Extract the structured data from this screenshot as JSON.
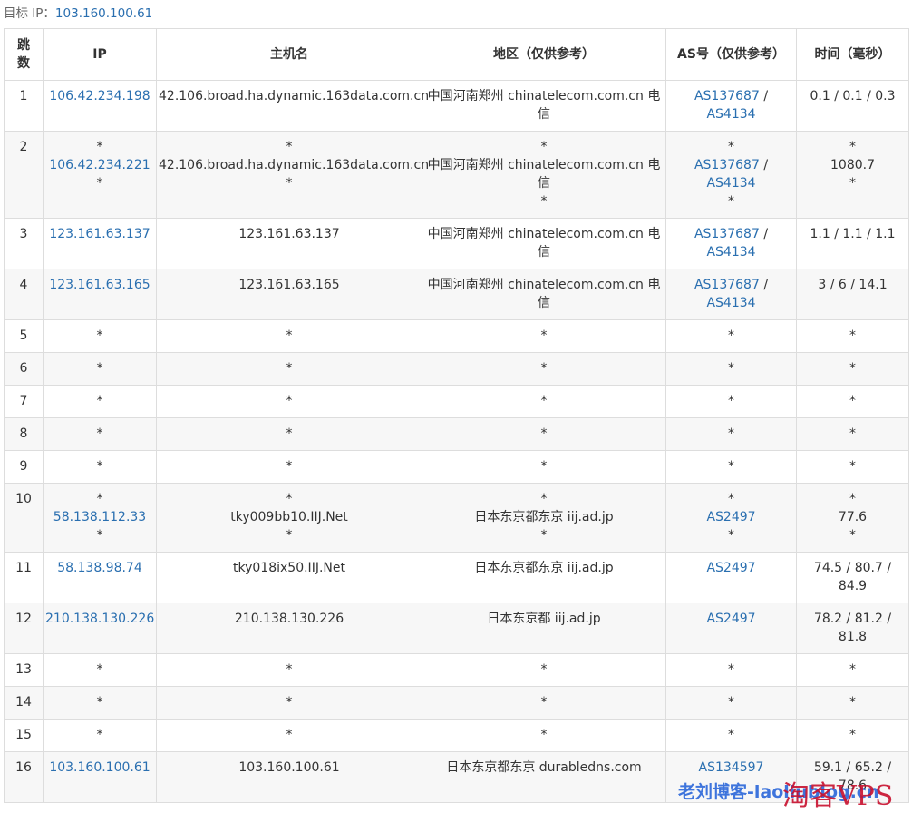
{
  "target": {
    "label": "目标 IP：",
    "ip": "103.160.100.61"
  },
  "headers": {
    "hop": "跳数",
    "ip": "IP",
    "host": "主机名",
    "region": "地区（仅供参考）",
    "as": "AS号（仅供参考）",
    "time": "时间（毫秒）"
  },
  "rows": [
    {
      "hop": "1",
      "ip": [
        {
          "t": "106.42.234.198",
          "link": true
        }
      ],
      "host": [
        "42.106.broad.ha.dynamic.163data.com.cn"
      ],
      "region": [
        "中国河南郑州 chinatelecom.com.cn 电",
        "信"
      ],
      "as": [
        [
          {
            "t": "AS137687",
            "link": true
          },
          {
            "t": " /",
            "link": false
          }
        ],
        [
          {
            "t": "AS4134",
            "link": true
          }
        ]
      ],
      "time": [
        "0.1 / 0.1 / 0.3"
      ]
    },
    {
      "hop": "2",
      "ip": [
        {
          "t": "*",
          "link": false
        },
        {
          "t": "106.42.234.221",
          "link": true
        },
        {
          "t": "*",
          "link": false
        }
      ],
      "host": [
        "*",
        "42.106.broad.ha.dynamic.163data.com.cn",
        "*"
      ],
      "region": [
        "*",
        "中国河南郑州 chinatelecom.com.cn 电",
        "信",
        "*"
      ],
      "as": [
        [
          {
            "t": "*",
            "link": false
          }
        ],
        [
          {
            "t": "AS137687",
            "link": true
          },
          {
            "t": " /",
            "link": false
          }
        ],
        [
          {
            "t": "AS4134",
            "link": true
          }
        ],
        [
          {
            "t": "*",
            "link": false
          }
        ]
      ],
      "time": [
        "*",
        "1080.7",
        "*"
      ]
    },
    {
      "hop": "3",
      "ip": [
        {
          "t": "123.161.63.137",
          "link": true
        }
      ],
      "host": [
        "123.161.63.137"
      ],
      "region": [
        "中国河南郑州 chinatelecom.com.cn 电",
        "信"
      ],
      "as": [
        [
          {
            "t": "AS137687",
            "link": true
          },
          {
            "t": " /",
            "link": false
          }
        ],
        [
          {
            "t": "AS4134",
            "link": true
          }
        ]
      ],
      "time": [
        "1.1 / 1.1 / 1.1"
      ]
    },
    {
      "hop": "4",
      "ip": [
        {
          "t": "123.161.63.165",
          "link": true
        }
      ],
      "host": [
        "123.161.63.165"
      ],
      "region": [
        "中国河南郑州 chinatelecom.com.cn 电",
        "信"
      ],
      "as": [
        [
          {
            "t": "AS137687",
            "link": true
          },
          {
            "t": " /",
            "link": false
          }
        ],
        [
          {
            "t": "AS4134",
            "link": true
          }
        ]
      ],
      "time": [
        "3 / 6 / 14.1"
      ]
    },
    {
      "hop": "5",
      "ip": [
        {
          "t": "*",
          "link": false
        }
      ],
      "host": [
        "*"
      ],
      "region": [
        "*"
      ],
      "as": [
        [
          {
            "t": "*",
            "link": false
          }
        ]
      ],
      "time": [
        "*"
      ]
    },
    {
      "hop": "6",
      "ip": [
        {
          "t": "*",
          "link": false
        }
      ],
      "host": [
        "*"
      ],
      "region": [
        "*"
      ],
      "as": [
        [
          {
            "t": "*",
            "link": false
          }
        ]
      ],
      "time": [
        "*"
      ]
    },
    {
      "hop": "7",
      "ip": [
        {
          "t": "*",
          "link": false
        }
      ],
      "host": [
        "*"
      ],
      "region": [
        "*"
      ],
      "as": [
        [
          {
            "t": "*",
            "link": false
          }
        ]
      ],
      "time": [
        "*"
      ]
    },
    {
      "hop": "8",
      "ip": [
        {
          "t": "*",
          "link": false
        }
      ],
      "host": [
        "*"
      ],
      "region": [
        "*"
      ],
      "as": [
        [
          {
            "t": "*",
            "link": false
          }
        ]
      ],
      "time": [
        "*"
      ]
    },
    {
      "hop": "9",
      "ip": [
        {
          "t": "*",
          "link": false
        }
      ],
      "host": [
        "*"
      ],
      "region": [
        "*"
      ],
      "as": [
        [
          {
            "t": "*",
            "link": false
          }
        ]
      ],
      "time": [
        "*"
      ]
    },
    {
      "hop": "10",
      "ip": [
        {
          "t": "*",
          "link": false
        },
        {
          "t": "58.138.112.33",
          "link": true
        },
        {
          "t": "*",
          "link": false
        }
      ],
      "host": [
        "*",
        "tky009bb10.IIJ.Net",
        "*"
      ],
      "region": [
        "*",
        "日本东京都东京 iij.ad.jp",
        "*"
      ],
      "as": [
        [
          {
            "t": "*",
            "link": false
          }
        ],
        [
          {
            "t": "AS2497",
            "link": true
          }
        ],
        [
          {
            "t": "*",
            "link": false
          }
        ]
      ],
      "time": [
        "*",
        "77.6",
        "*"
      ]
    },
    {
      "hop": "11",
      "ip": [
        {
          "t": "58.138.98.74",
          "link": true
        }
      ],
      "host": [
        "tky018ix50.IIJ.Net"
      ],
      "region": [
        "日本东京都东京 iij.ad.jp"
      ],
      "as": [
        [
          {
            "t": "AS2497",
            "link": true
          }
        ]
      ],
      "time": [
        "74.5 / 80.7 /",
        "84.9"
      ]
    },
    {
      "hop": "12",
      "ip": [
        {
          "t": "210.138.130.226",
          "link": true
        }
      ],
      "host": [
        "210.138.130.226"
      ],
      "region": [
        "日本东京都 iij.ad.jp"
      ],
      "as": [
        [
          {
            "t": "AS2497",
            "link": true
          }
        ]
      ],
      "time": [
        "78.2 / 81.2 /",
        "81.8"
      ]
    },
    {
      "hop": "13",
      "ip": [
        {
          "t": "*",
          "link": false
        }
      ],
      "host": [
        "*"
      ],
      "region": [
        "*"
      ],
      "as": [
        [
          {
            "t": "*",
            "link": false
          }
        ]
      ],
      "time": [
        "*"
      ]
    },
    {
      "hop": "14",
      "ip": [
        {
          "t": "*",
          "link": false
        }
      ],
      "host": [
        "*"
      ],
      "region": [
        "*"
      ],
      "as": [
        [
          {
            "t": "*",
            "link": false
          }
        ]
      ],
      "time": [
        "*"
      ]
    },
    {
      "hop": "15",
      "ip": [
        {
          "t": "*",
          "link": false
        }
      ],
      "host": [
        "*"
      ],
      "region": [
        "*"
      ],
      "as": [
        [
          {
            "t": "*",
            "link": false
          }
        ]
      ],
      "time": [
        "*"
      ]
    },
    {
      "hop": "16",
      "ip": [
        {
          "t": "103.160.100.61",
          "link": true
        }
      ],
      "host": [
        "103.160.100.61"
      ],
      "region": [
        "日本东京都东京 durabledns.com"
      ],
      "as": [
        [
          {
            "t": "AS134597",
            "link": true
          }
        ]
      ],
      "time": [
        "59.1 / 65.2 /",
        "78.6"
      ]
    }
  ],
  "watermark": {
    "text": "老刘博客-laoliublog.cn",
    "logo": "淘客VPS"
  },
  "colors": {
    "link": "#2a6fb0",
    "border": "#dddddd",
    "stripe": "#f7f7f7",
    "watermark_blue": "#1e5ed8",
    "watermark_red": "#c8102e"
  }
}
